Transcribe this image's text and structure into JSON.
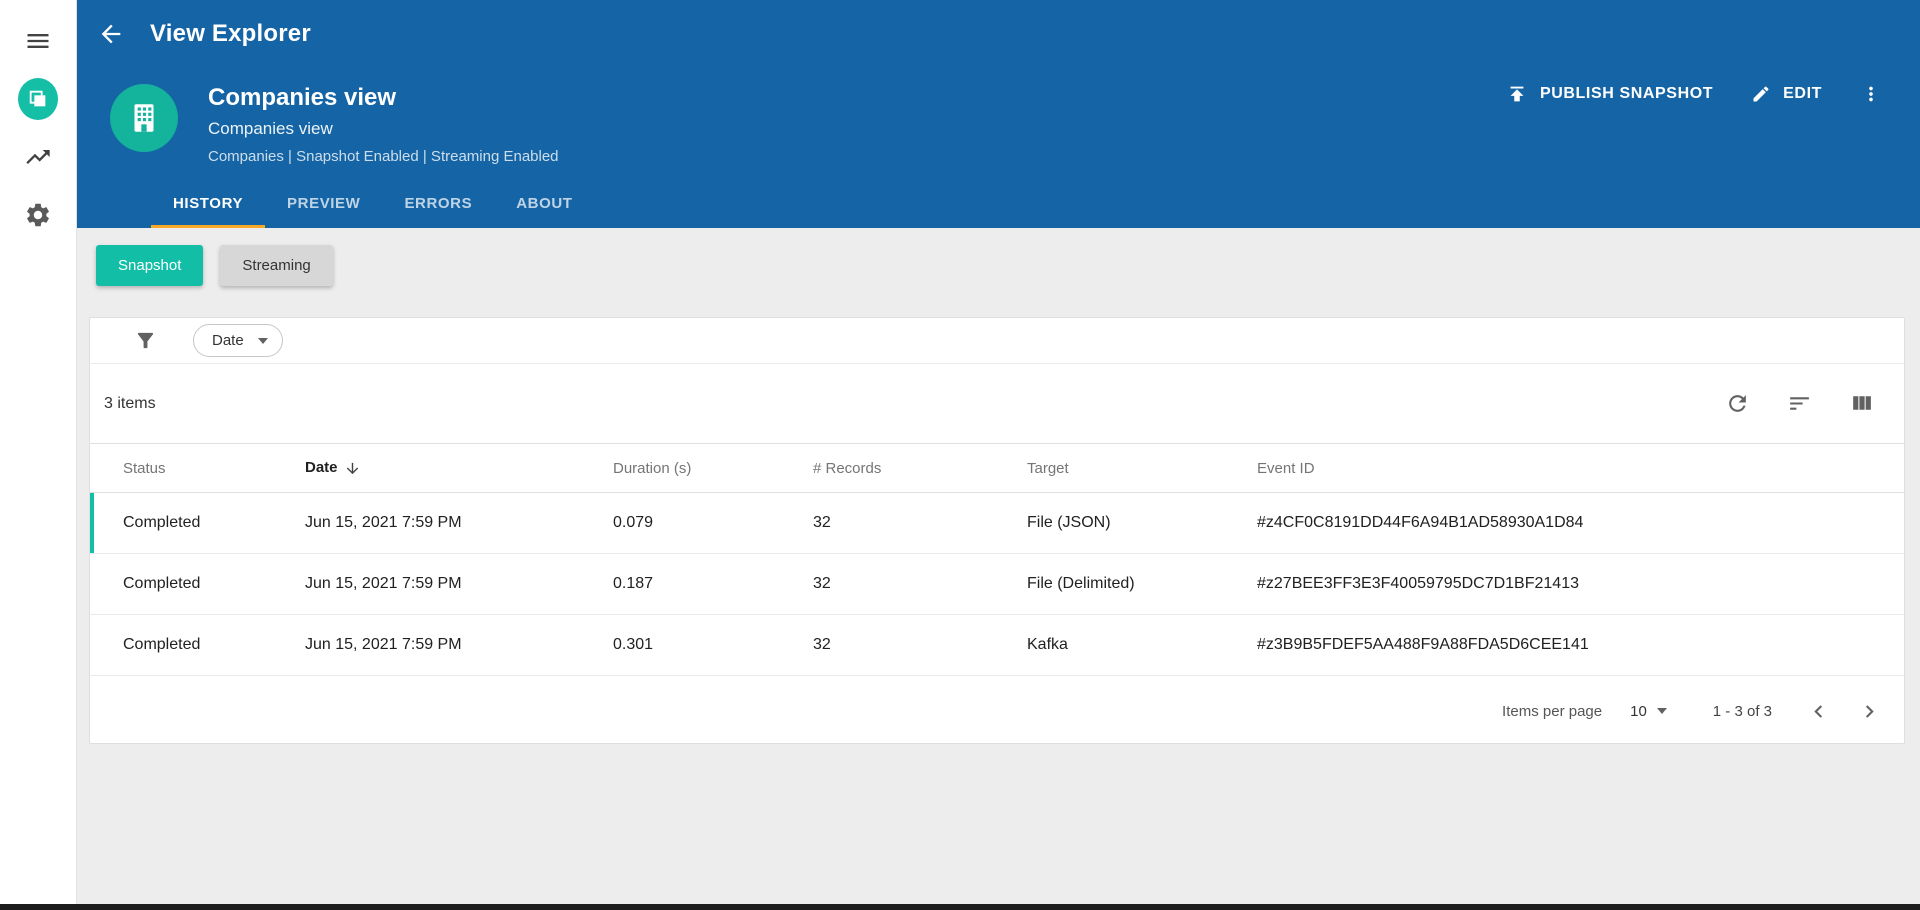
{
  "app": {
    "title": "View Explorer"
  },
  "sidebar": {
    "icons": [
      "menu-icon",
      "app-logo-icon",
      "trending-chart-icon",
      "settings-gear-icon"
    ]
  },
  "header": {
    "entity": {
      "title": "Companies view",
      "subtitle": "Companies view",
      "meta": "Companies | Snapshot Enabled | Streaming Enabled"
    },
    "actions": {
      "publish": "PUBLISH SNAPSHOT",
      "edit": "EDIT"
    },
    "tabs": [
      {
        "label": "HISTORY",
        "active": true
      },
      {
        "label": "PREVIEW",
        "active": false
      },
      {
        "label": "ERRORS",
        "active": false
      },
      {
        "label": "ABOUT",
        "active": false
      }
    ]
  },
  "toggles": [
    {
      "label": "Snapshot",
      "active": true
    },
    {
      "label": "Streaming",
      "active": false
    }
  ],
  "filterbar": {
    "filter_label": "Date"
  },
  "table": {
    "summary": "3 items",
    "columns": [
      "Status",
      "Date",
      "Duration (s)",
      "# Records",
      "Target",
      "Event ID"
    ],
    "sort_column": "Date",
    "sort_direction": "desc",
    "rows": [
      {
        "status": "Completed",
        "date": "Jun 15, 2021 7:59 PM",
        "duration": "0.079",
        "records": "32",
        "target": "File (JSON)",
        "event_id": "#z4CF0C8191DD44F6A94B1AD58930A1D84"
      },
      {
        "status": "Completed",
        "date": "Jun 15, 2021 7:59 PM",
        "duration": "0.187",
        "records": "32",
        "target": "File (Delimited)",
        "event_id": "#z27BEE3FF3E3F40059795DC7D1BF21413"
      },
      {
        "status": "Completed",
        "date": "Jun 15, 2021 7:59 PM",
        "duration": "0.301",
        "records": "32",
        "target": "Kafka",
        "event_id": "#z3B9B5FDEF5AA488F9A88FDA5D6CEE141"
      }
    ]
  },
  "pagination": {
    "items_per_page_label": "Items per page",
    "items_per_page_value": "10",
    "range": "1 - 3 of 3"
  },
  "colors": {
    "header_blue": "#1564a5",
    "accent_teal": "#12bfa6",
    "tab_underline": "#f9a825"
  }
}
